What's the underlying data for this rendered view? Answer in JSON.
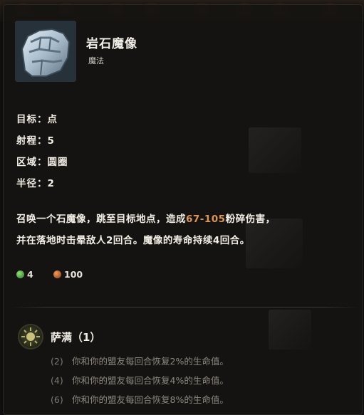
{
  "skill": {
    "name": "岩石魔像",
    "type": "魔法"
  },
  "stats": [
    {
      "label": "目标：",
      "value": "点"
    },
    {
      "label": "射程：",
      "value": "5"
    },
    {
      "label": "区域：",
      "value": "圆圈"
    },
    {
      "label": "半径：",
      "value": "2"
    }
  ],
  "description": {
    "line1_pre": "召唤一个石魔像，跳至目标地点，造成",
    "damage": "67-105",
    "line1_post": "粉碎伤害，",
    "line2": "并在落地时击晕敌人2回合。魔像的寿命持续4回合。"
  },
  "costs": {
    "action_points": "4",
    "mana": "100"
  },
  "talent": {
    "name": "萨满（1）",
    "levels": [
      {
        "level": "(2)",
        "text": "你和你的盟友每回合恢复2%的生命值。"
      },
      {
        "level": "(4)",
        "text": "你和你的盟友每回合恢复4%的生命值。"
      },
      {
        "level": "(6)",
        "text": "你和你的盟友每回合恢复8%的生命值。"
      }
    ]
  },
  "colors": {
    "damage": "#d9955a",
    "action_point": "#4fae3c",
    "mana": "#c8602a"
  },
  "icons": {
    "skill": "rock-golem-fist-icon",
    "talent": "shaman-emblem-icon"
  }
}
